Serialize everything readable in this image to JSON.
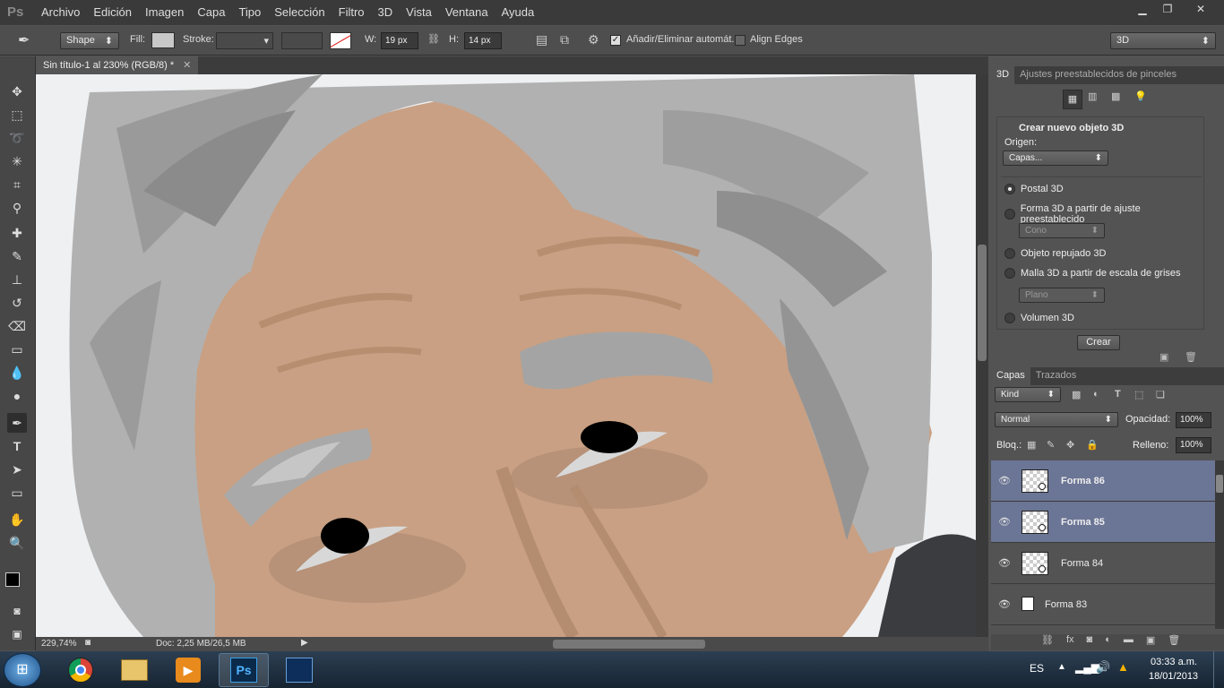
{
  "app": {
    "logo": "Ps"
  },
  "menu": [
    "Archivo",
    "Edición",
    "Imagen",
    "Capa",
    "Tipo",
    "Selección",
    "Filtro",
    "3D",
    "Vista",
    "Ventana",
    "Ayuda"
  ],
  "options": {
    "shape_mode": "Shape",
    "fill_label": "Fill:",
    "stroke_label": "Stroke:",
    "w_label": "W:",
    "w_value": "19 px",
    "h_label": "H:",
    "h_value": "14 px",
    "auto_add_label": "Añadir/Eliminar automát.",
    "align_edges_label": "Align Edges",
    "workspace": "3D"
  },
  "document": {
    "tab_title": "Sin título-1 al 230% (RGB/8) *"
  },
  "status": {
    "zoom": "229,74%",
    "doc": "Doc: 2,25 MB/26,5 MB"
  },
  "panel3d": {
    "tabs": [
      "3D",
      "Ajustes preestablecidos de pinceles"
    ],
    "heading": "Crear nuevo objeto 3D",
    "origin_label": "Origen:",
    "origin_value": "Capas...",
    "options": [
      "Postal 3D",
      "Forma 3D a partir de ajuste preestablecido",
      "Objeto repujado 3D",
      "Malla 3D a partir de escala de grises",
      "Volumen 3D"
    ],
    "preset_value": "Cono",
    "mesh_value": "Plano",
    "create_button": "Crear"
  },
  "layers_panel": {
    "tabs": [
      "Capas",
      "Trazados"
    ],
    "kind": "Kind",
    "blend": "Normal",
    "opacity_label": "Opacidad:",
    "opacity": "100%",
    "lock_label": "Bloq.:",
    "fill_label": "Relleno:",
    "fill": "100%",
    "layers": [
      {
        "name": "Forma 86",
        "selected": true
      },
      {
        "name": "Forma 85",
        "selected": true
      },
      {
        "name": "Forma 84",
        "selected": false
      },
      {
        "name": "Forma 83",
        "selected": false
      }
    ]
  },
  "taskbar": {
    "lang": "ES",
    "time": "03:33 a.m.",
    "date": "18/01/2013"
  }
}
